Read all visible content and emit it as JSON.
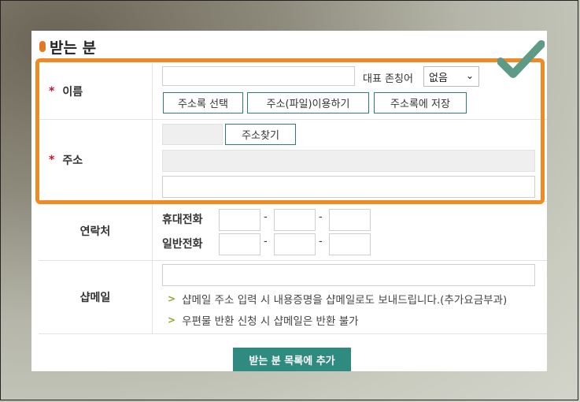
{
  "section_title": "받는 분",
  "name_row": {
    "label": "이름",
    "required_mark": "*",
    "honorific_label": "대표 존칭어",
    "honorific_select": "없음",
    "btn_address_book": "주소록 선택",
    "btn_file": "주소(파일)이용하기",
    "btn_save": "주소록에 저장"
  },
  "address_row": {
    "label": "주소",
    "required_mark": "*",
    "btn_find": "주소찾기"
  },
  "contact_row": {
    "label": "연락처",
    "mobile_label": "휴대전화",
    "phone_label": "일반전화",
    "dash": "-"
  },
  "shopmail_row": {
    "label": "샵메일",
    "note1": "샵메일 주소 입력 시 내용증명을 샵메일로도 보내드립니다.(추가요금부과)",
    "note2": "우편물 반환 신청 시 샵메일은 반환 불가"
  },
  "add_button": "받는 분 목록에 추가",
  "colors": {
    "accent": "#2f8a80",
    "highlight": "#f08a24",
    "required": "#c8102e",
    "check": "#5e9b86"
  }
}
